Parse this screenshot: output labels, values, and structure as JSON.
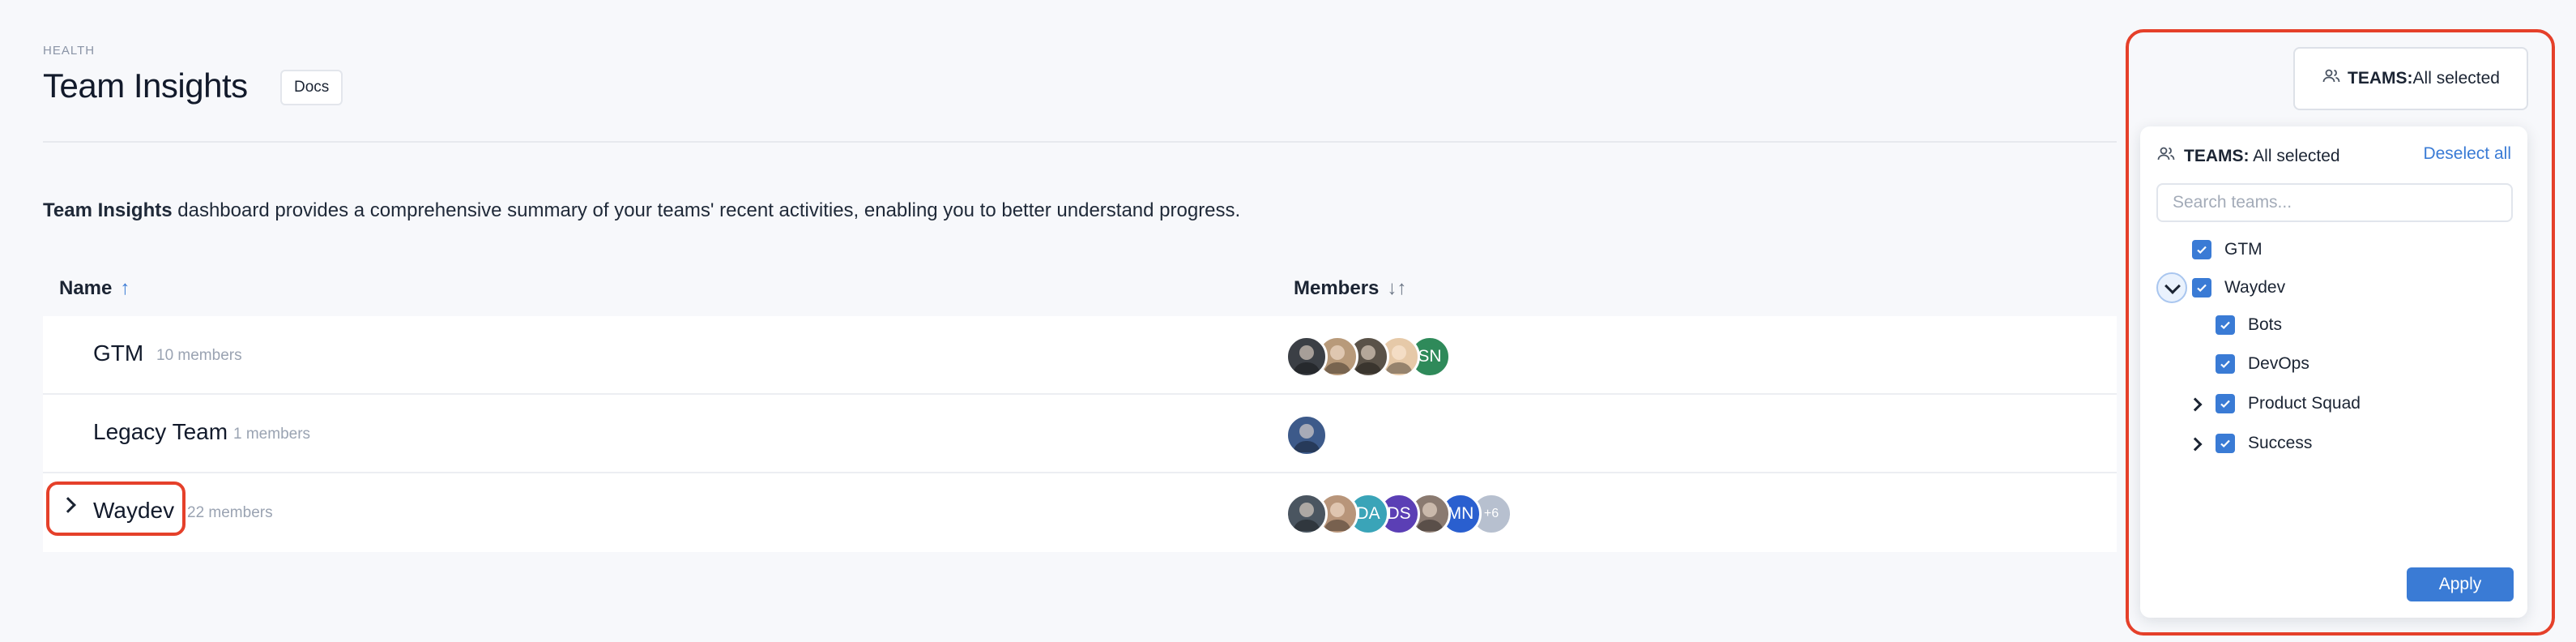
{
  "header": {
    "breadcrumb": "HEALTH",
    "title": "Team Insights",
    "docs_label": "Docs",
    "description_bold": "Team Insights",
    "description_rest": " dashboard provides a comprehensive summary of your teams' recent activities, enabling you to better understand progress."
  },
  "table": {
    "columns": [
      {
        "label": "Name",
        "sort": "ascending",
        "sort_icon": "arrow-up-icon"
      },
      {
        "label": "Members",
        "sort": "none",
        "sort_icon": "sort-icon"
      }
    ],
    "rows": [
      {
        "name": "GTM",
        "count": "10 members",
        "expandable": false,
        "avatars": [
          {
            "type": "photo",
            "color": "#3b3f45"
          },
          {
            "type": "photo",
            "color": "#b89a7a"
          },
          {
            "type": "photo",
            "color": "#5a5248"
          },
          {
            "type": "photo",
            "color": "#e6c9a8"
          },
          {
            "type": "initials",
            "text": "SN",
            "color": "#2f8a5a"
          }
        ]
      },
      {
        "name": "Legacy Team",
        "count": "1 members",
        "expandable": false,
        "avatars": [
          {
            "type": "photo",
            "color": "#3d5a8a"
          }
        ]
      },
      {
        "name": "Waydev",
        "count": "22 members",
        "expandable": true,
        "avatars": [
          {
            "type": "photo",
            "color": "#4a5560"
          },
          {
            "type": "photo",
            "color": "#b8957a"
          },
          {
            "type": "initials",
            "text": "DA",
            "color": "#3aa4b8"
          },
          {
            "type": "initials",
            "text": "DS",
            "color": "#5b3fb5"
          },
          {
            "type": "photo",
            "color": "#8a7a70"
          },
          {
            "type": "initials",
            "text": "MN",
            "color": "#2a5fcf"
          },
          {
            "type": "initials",
            "text": "+6",
            "color": "#b7c0cf"
          }
        ]
      }
    ]
  },
  "teams_filter": {
    "button_bold": "TEAMS:",
    "button_value": "All selected",
    "head_bold": "TEAMS:",
    "head_value": " All selected",
    "deselect_label": "Deselect all",
    "search_placeholder": "Search teams...",
    "options": [
      {
        "label": "GTM",
        "checked": true,
        "level": 0,
        "expander": "none"
      },
      {
        "label": "Waydev",
        "checked": true,
        "level": 0,
        "expander": "expanded"
      },
      {
        "label": "Bots",
        "checked": true,
        "level": 1,
        "expander": "none"
      },
      {
        "label": "DevOps",
        "checked": true,
        "level": 1,
        "expander": "none"
      },
      {
        "label": "Product Squad",
        "checked": true,
        "level": 1,
        "expander": "collapsed"
      },
      {
        "label": "Success",
        "checked": true,
        "level": 1,
        "expander": "collapsed"
      }
    ],
    "apply_label": "Apply"
  },
  "colors": {
    "accent": "#3a7bd5",
    "highlight": "#e5402a"
  }
}
